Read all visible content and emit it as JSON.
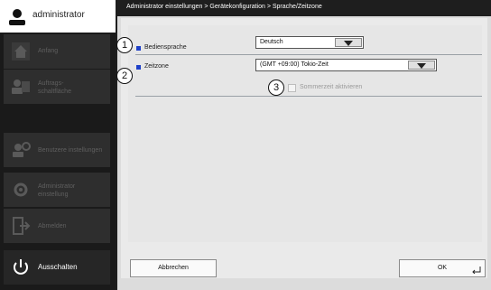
{
  "user": {
    "name": "administrator",
    "icon": "user-icon"
  },
  "nav": [
    {
      "label": "Anfang",
      "icon": "home-icon"
    },
    {
      "label": "Auftrags-\nschaltfläche",
      "icon": "job-button-icon"
    },
    {
      "label": "Benutzere instellungen",
      "icon": "user-settings-icon"
    },
    {
      "label": "Administrator\neinstellung",
      "icon": "admin-gear-icon"
    },
    {
      "label": "Abmelden",
      "icon": "logout-icon"
    },
    {
      "label": "Ausschalten",
      "icon": "power-icon"
    }
  ],
  "breadcrumb": "Administrator einstellungen > Gerätekonfiguration > Sprache/Zeitzone",
  "settings": {
    "language": {
      "number": "1",
      "label": "Bediensprache",
      "value": "Deutsch"
    },
    "timezone": {
      "number": "2",
      "label": "Zeitzone",
      "value": "(GMT +09:00) Tokio-Zeit"
    },
    "dst": {
      "number": "3",
      "label": "Sommerzeit aktivieren",
      "checked": false
    }
  },
  "buttons": {
    "cancel": "Abbrechen",
    "ok": "OK"
  },
  "colors": {
    "bullet": "#1e40c8",
    "sidebar": "#1a1a1a",
    "content": "#eaeaea"
  }
}
